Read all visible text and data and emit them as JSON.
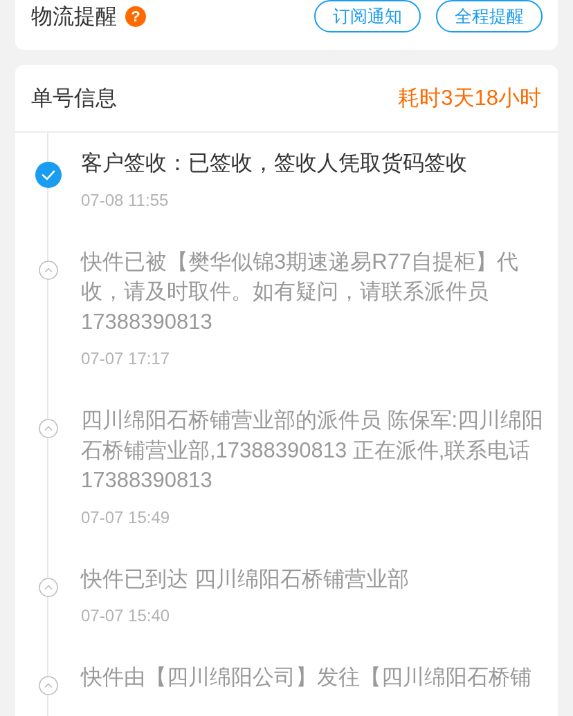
{
  "reminder": {
    "title": "物流提醒",
    "help_icon": "?",
    "buttons": [
      "订阅通知",
      "全程提醒"
    ]
  },
  "tracking": {
    "title": "单号信息",
    "duration": "耗时3天18小时",
    "events": [
      {
        "text": "客户签收：已签收，签收人凭取货码签收",
        "time": "07-08 11:55",
        "current": true
      },
      {
        "text": "快件已被【樊华似锦3期速递易R77自提柜】代收，请及时取件。如有疑问，请联系派件员17388390813",
        "time": "07-07 17:17",
        "current": false
      },
      {
        "text": "四川绵阳石桥铺营业部的派件员 陈保军:四川绵阳石桥铺营业部,17388390813 正在派件,联系电话 17388390813",
        "time": "07-07 15:49",
        "current": false
      },
      {
        "text": "快件已到达 四川绵阳石桥铺营业部",
        "time": "07-07 15:40",
        "current": false
      },
      {
        "text": "快件由【四川绵阳公司】发往【四川绵阳石桥铺",
        "current": false
      }
    ]
  }
}
